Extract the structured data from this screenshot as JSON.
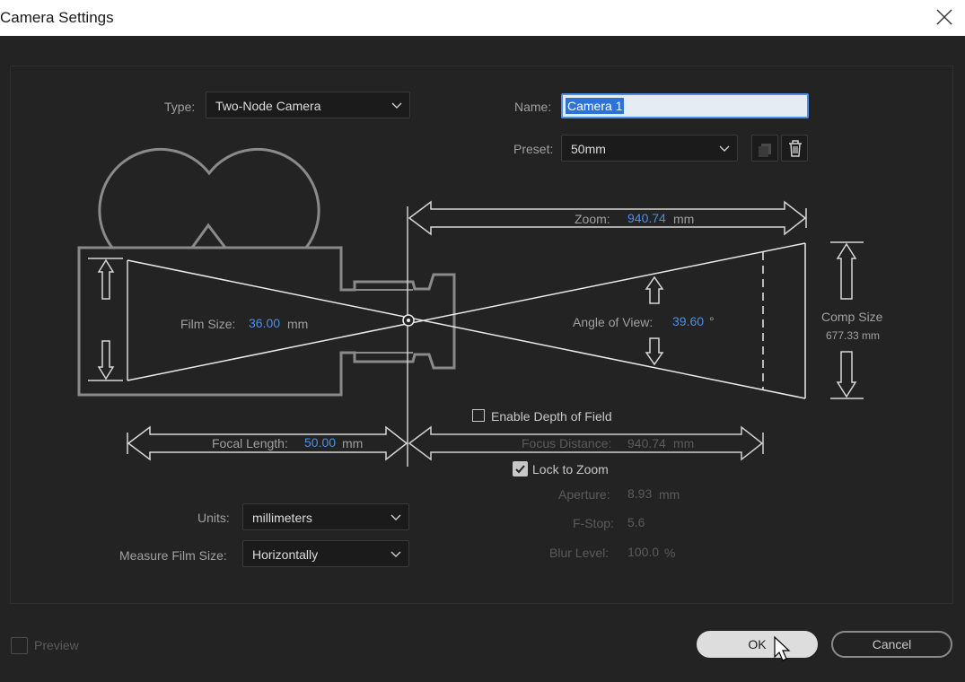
{
  "window": {
    "title": "Camera Settings",
    "close_icon": "close-icon"
  },
  "type": {
    "label": "Type:",
    "value": "Two-Node Camera"
  },
  "name": {
    "label": "Name:",
    "value": "Camera 1"
  },
  "preset": {
    "label": "Preset:",
    "value": "50mm"
  },
  "zoom": {
    "label": "Zoom:",
    "value": "940.74",
    "unit": "mm"
  },
  "film_size": {
    "label": "Film Size:",
    "value": "36.00",
    "unit": "mm"
  },
  "angle_of_view": {
    "label": "Angle of View:",
    "value": "39.60",
    "unit": "°"
  },
  "comp_size": {
    "label": "Comp Size",
    "value": "677.33 mm"
  },
  "focal_length": {
    "label": "Focal Length:",
    "value": "50.00",
    "unit": "mm"
  },
  "depth_of_field": {
    "label": "Enable Depth of Field",
    "checked": false
  },
  "focus_distance": {
    "label": "Focus Distance:",
    "value": "940.74",
    "unit": "mm"
  },
  "lock_to_zoom": {
    "label": "Lock to Zoom",
    "checked": true
  },
  "aperture": {
    "label": "Aperture:",
    "value": "8.93",
    "unit": "mm"
  },
  "f_stop": {
    "label": "F-Stop:",
    "value": "5.6"
  },
  "blur_level": {
    "label": "Blur Level:",
    "value": "100.0",
    "unit": "%"
  },
  "units": {
    "label": "Units:",
    "value": "millimeters"
  },
  "measure_film_size": {
    "label": "Measure Film Size:",
    "value": "Horizontally"
  },
  "preview": {
    "label": "Preview",
    "checked": false
  },
  "buttons": {
    "ok": "OK",
    "cancel": "Cancel"
  },
  "colors": {
    "accent": "#4a90e8",
    "background": "#232323",
    "text": "#a0a0a0",
    "disabled": "#5b5b5b"
  }
}
